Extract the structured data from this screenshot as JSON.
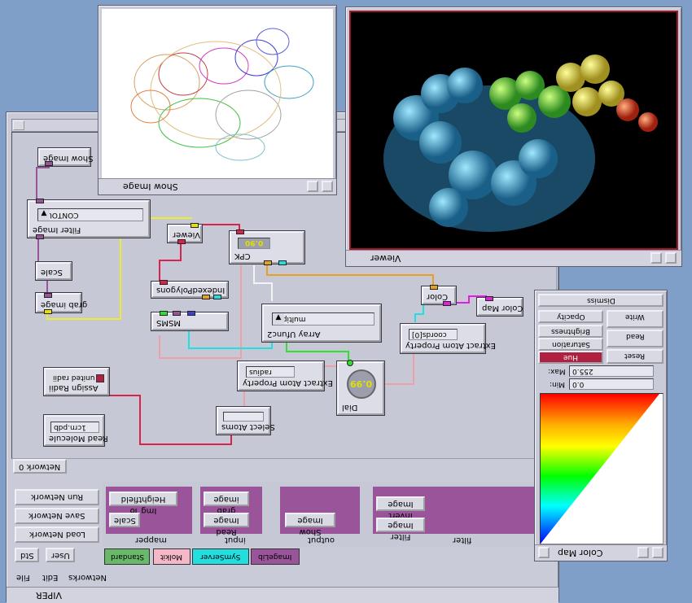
{
  "main_window": {
    "title": "VIPER",
    "menu": [
      "File",
      "Edit",
      "Networks"
    ],
    "tabs_bottom": [
      "Std",
      "User"
    ],
    "side_buttons": [
      "Load Network",
      "Save Network",
      "Run Network"
    ],
    "network_tab": "Network 0",
    "library_tabs": [
      {
        "label": "Standard",
        "color": "#6ab86a"
      },
      {
        "label": "Molkit",
        "color": "#f4b8c8"
      },
      {
        "label": "SymServer",
        "color": "#22dede"
      },
      {
        "label": "ImageLib",
        "color": "#9a559a"
      }
    ],
    "categories": [
      "mapper",
      "input",
      "output",
      "filter"
    ],
    "palette": {
      "mapper": [
        "Scale",
        "Img To Heightfield"
      ],
      "input": [
        "Read Image",
        "grab image"
      ],
      "output": [
        "Show Image"
      ],
      "filter": [
        "Filter Image",
        "Invert Image"
      ]
    }
  },
  "nodes": {
    "show_image": "Show Image",
    "filter_image": "Filter Image",
    "contour": "CONTOUR",
    "scale": "Scale",
    "grab_image": "grab image",
    "viewer": "Viewer",
    "cpk": "CPK",
    "cpk_value": "0.90",
    "indexed_polygons": "IndexedPolygons",
    "msms": "MSMS",
    "array_ufunc": "Array Ufunc2",
    "multiply": "multiply",
    "color": "Color",
    "color_map": "Color Map",
    "extract_coords": "Extract Atom Property",
    "coords_field": "coords[0]",
    "extract_radius": "Extract Atom Property",
    "radius_field": "radius",
    "dial": "Dial",
    "dial_value": "0.99",
    "assign_radii": "Assign Radii",
    "united_radii": "united radii",
    "read_molecule": "Read Molecule",
    "mol_field": "1crn.pdb",
    "select_atoms": "Select Atoms"
  },
  "show_image_window": {
    "title": "Show Image"
  },
  "viewer_window": {
    "title": "Viewer"
  },
  "color_map_window": {
    "title": "Color Map",
    "min_label": "Min:",
    "min_value": "0.0",
    "max_label": "Max:",
    "max_value": "255.0",
    "left_buttons": [
      "Hue",
      "Saturation",
      "Brightness",
      "Opacity"
    ],
    "right_buttons": [
      "Reset",
      "Read",
      "Write"
    ],
    "dismiss": "Dismiss"
  },
  "colors": {
    "window": "#c9cbd8",
    "desktop": "#7f9ec8",
    "palette_purple": "#9a559a"
  }
}
